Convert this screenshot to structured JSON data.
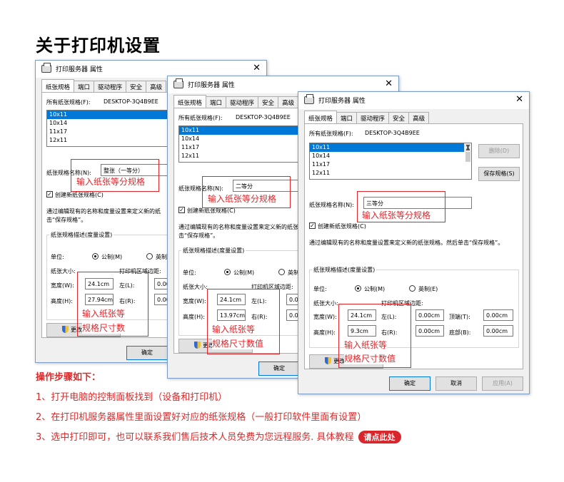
{
  "page": {
    "title": "关于打印机设置",
    "steps_title": "操作步骤如下：",
    "steps": [
      "1、打开电脑的控制面板找到（设备和打印机）",
      "2、在打印机服务器属性里面设置好对应的纸张规格（一般打印软件里面有设置）",
      "3、选中打印即可，也可以联系我们售后技术人员免费为您远程服务. 具体教程"
    ],
    "tutorial_link": "请点此处"
  },
  "dialog": {
    "title": "打印服务器 属性",
    "close_glyph": "✕",
    "tabs": [
      "纸张规格",
      "端口",
      "驱动程序",
      "安全",
      "高级"
    ],
    "all_forms_label": "所有纸张规格(F):",
    "computer_name": "DESKTOP-3Q4B9EE",
    "forms": [
      "10x11",
      "10x14",
      "11x17",
      "12x11"
    ],
    "delete_button": "删除(D)",
    "save_button": "保存规格(S)",
    "form_name_label": "纸张规格名称(N):",
    "create_new_label": "创建新纸张规格(C)",
    "description": "通过编辑现有的名称和度量设置来定义新的纸张规格。然后单击“保存规格”。",
    "description_cut_1": "通过编辑现有的名称和度量设置来定义新的纸",
    "description_cut_2": "通过编辑现有的名称和度量设置来定义新的纸张",
    "description_line_2": "击“保存规格”。",
    "measurements_group": "纸张规格描述(度量设置)",
    "units_label": "单位:",
    "metric": "公制(M)",
    "english": "英制(E)",
    "english_cut": "英制(",
    "paper_size_label": "纸张大小:",
    "margins_label": "打印机区域边距:",
    "width_label": "宽度(W):",
    "height_label": "高度(H):",
    "left_label": "左(L):",
    "right_label": "右(R):",
    "top_label": "顶端(T):",
    "bottom_label": "底部(B):",
    "change_settings": "更改规格设置",
    "change_settings_cut": "更改",
    "ok": "确定",
    "cancel": "取消",
    "apply": "应用(A)"
  },
  "dialogs": [
    {
      "form_name": "整张（一等分）",
      "width": "24.1cm",
      "height": "27.94cm",
      "margin_left": "0.00",
      "margin_right": "0.00"
    },
    {
      "form_name": "二等分",
      "width": "24.1cm",
      "height": "13.97cm",
      "margin_left": "0.00",
      "margin_right": "0.00"
    },
    {
      "form_name": "三等分",
      "width": "24.1cm",
      "height": "9.3cm",
      "margin_left": "0.00cm",
      "margin_right": "0.00cm",
      "margin_top": "0.00cm",
      "margin_bottom": "0.00cm"
    }
  ],
  "annotations": {
    "form_name_hint": "输入纸张等分规格",
    "size_hint_1": "输入纸张等",
    "size_hint_2": "规格尺寸数值",
    "size_hint_2_cut": "规格尺寸数"
  },
  "colors": {
    "accent_red": "#e0262b",
    "selection_blue": "#0078d7"
  }
}
